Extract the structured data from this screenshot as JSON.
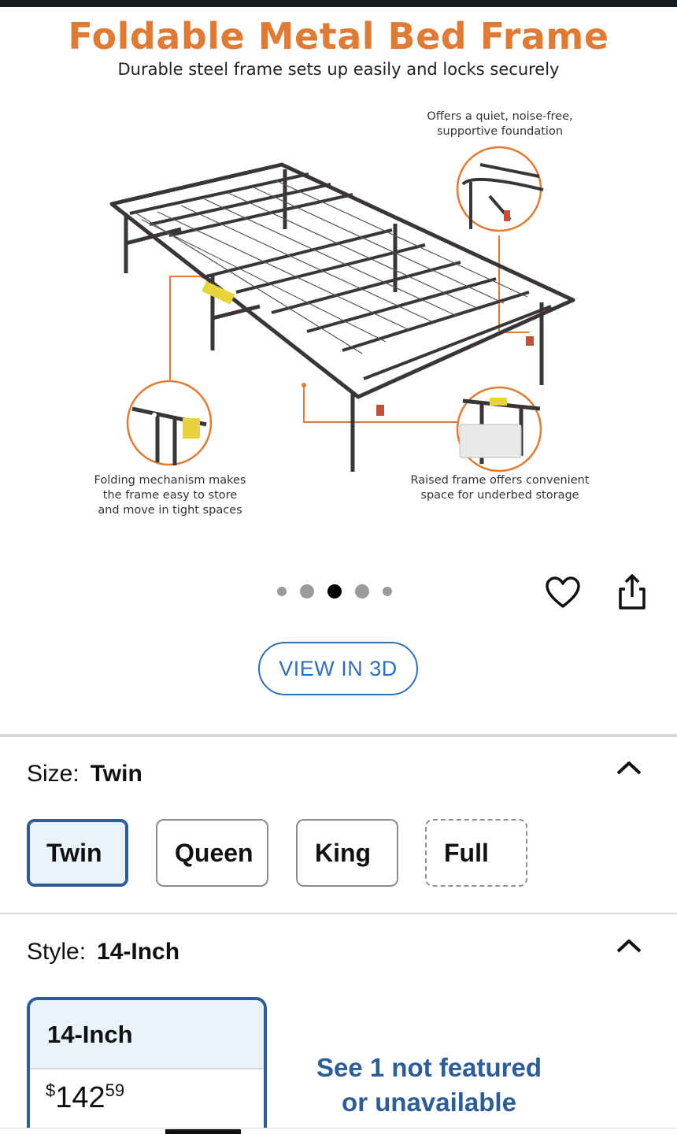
{
  "hero": {
    "title": "Foldable Metal Bed Frame",
    "subtitle": "Durable steel frame sets up easily and locks securely",
    "callouts": {
      "top_right_1": "Offers a quiet, noise-free,",
      "top_right_2": "supportive foundation",
      "bottom_left_1": "Folding mechanism makes",
      "bottom_left_2": "the frame easy to store",
      "bottom_left_3": "and move in tight spaces",
      "bottom_right_1": "Raised frame offers convenient",
      "bottom_right_2": "space for underbed storage"
    },
    "accent_color": "#e07b35"
  },
  "carousel": {
    "dot_count": 5,
    "active_index": 2
  },
  "actions": {
    "wishlist_icon": "heart-outline-icon",
    "share_icon": "share-icon",
    "view_3d_label": "VIEW IN 3D"
  },
  "size": {
    "label": "Size:",
    "selected": "Twin",
    "options": [
      {
        "label": "Twin",
        "state": "selected"
      },
      {
        "label": "Queen",
        "state": "available"
      },
      {
        "label": "King",
        "state": "available"
      },
      {
        "label": "Full",
        "state": "unavailable"
      }
    ]
  },
  "style": {
    "label": "Style:",
    "selected": "14-Inch",
    "card": {
      "name": "14-Inch",
      "currency": "$",
      "price_whole": "142",
      "price_fraction": "59"
    },
    "see_more_line1": "See 1 not featured",
    "see_more_line2": "or unavailable"
  },
  "colors": {
    "link_blue": "#2d5d95",
    "selected_bg": "#eaf3fc"
  }
}
